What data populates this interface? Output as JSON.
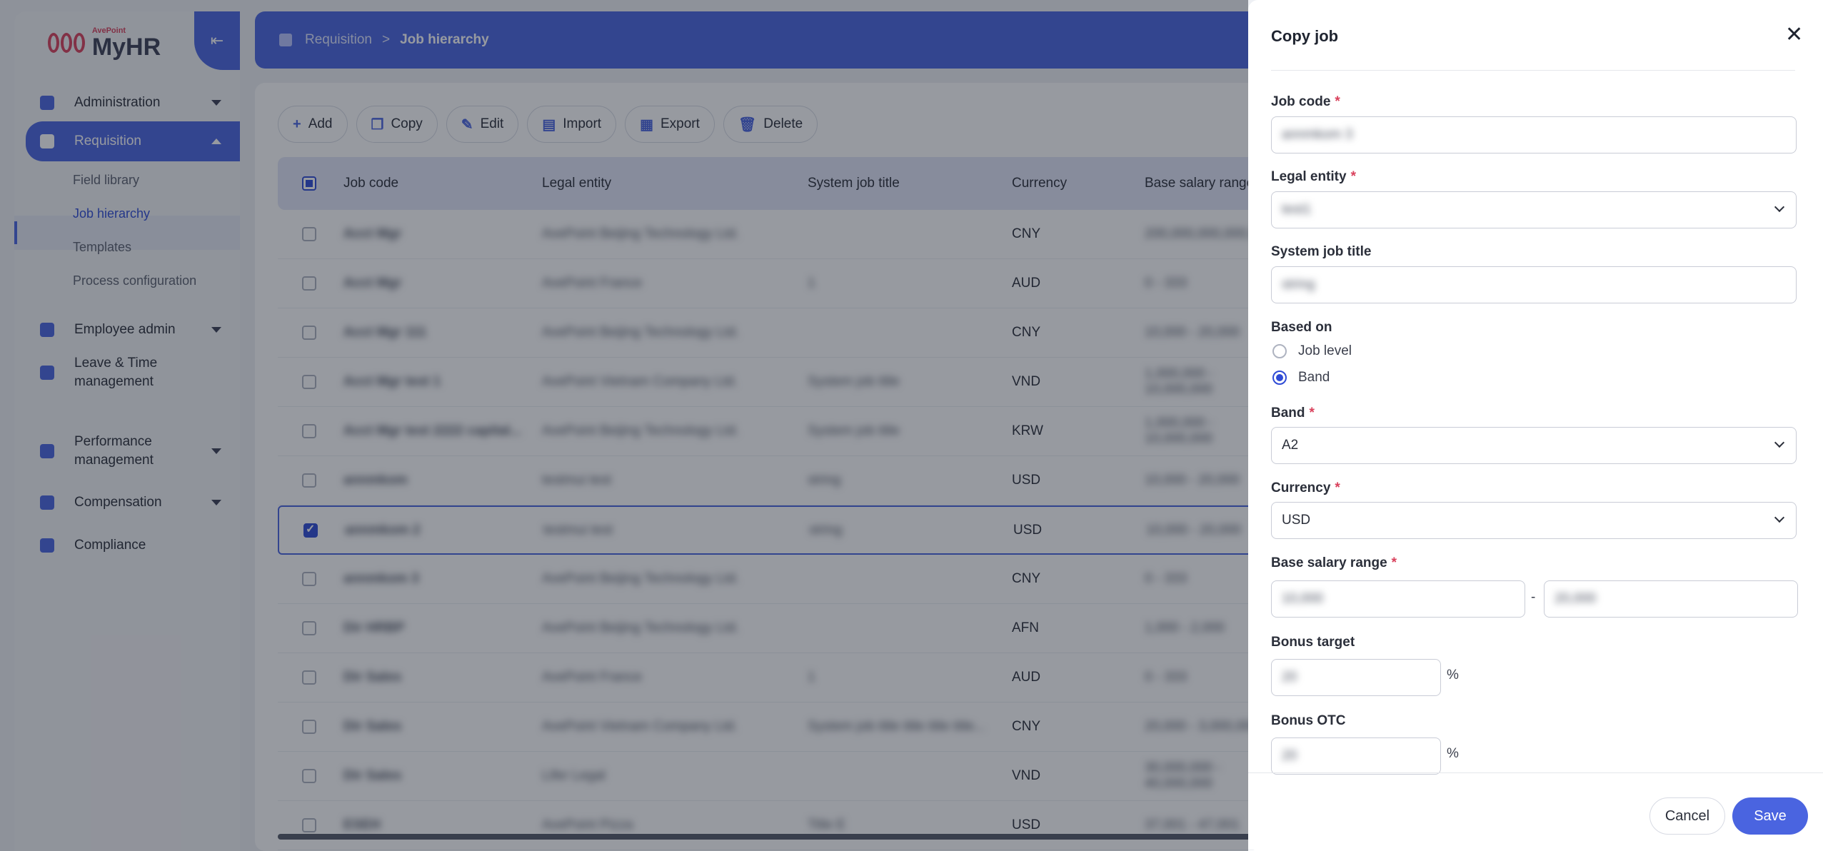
{
  "app": {
    "brand_small": "AvePoint",
    "brand": "MyHR"
  },
  "sidebar": {
    "items": [
      {
        "label": "Administration",
        "icon": "gear-icon"
      },
      {
        "label": "Requisition",
        "icon": "briefcase-icon"
      },
      {
        "label": "Employee admin",
        "icon": "badge-icon"
      },
      {
        "label": "Leave & Time management",
        "icon": "calendar-icon"
      },
      {
        "label": "Performance management",
        "icon": "people-icon"
      },
      {
        "label": "Compensation",
        "icon": "wallet-icon"
      },
      {
        "label": "Compliance",
        "icon": "shield-icon"
      }
    ],
    "leave_line1": "Leave & Time",
    "leave_line2": "management",
    "perf_line1": "Performance",
    "perf_line2": "management",
    "sub_items": [
      "Field library",
      "Job hierarchy",
      "Templates",
      "Process configuration"
    ]
  },
  "breadcrumb": {
    "parent": "Requisition",
    "separator": ">",
    "current": "Job hierarchy"
  },
  "toolbar": {
    "add": "Add",
    "copy": "Copy",
    "edit": "Edit",
    "import": "Import",
    "export": "Export",
    "delete": "Delete"
  },
  "table": {
    "columns": [
      "Job code",
      "Legal entity",
      "System job title",
      "Currency",
      "Base salary range"
    ],
    "rows": [
      {
        "code": "Acct Mgr",
        "entity": "AvePoint Beijing Technology Ltd.",
        "title": "",
        "currency": "CNY",
        "range": "200,000,000,000,000"
      },
      {
        "code": "Acct Mgr",
        "entity": "AvePoint France",
        "title": "1",
        "currency": "AUD",
        "range": "0 - 333"
      },
      {
        "code": "Acct Mgr 111",
        "entity": "AvePoint Beijing Technology Ltd.",
        "title": "",
        "currency": "CNY",
        "range": "10,000 - 20,000"
      },
      {
        "code": "Acct Mgr test 1",
        "entity": "AvePoint Vietnam Company Ltd.",
        "title": "System job title",
        "currency": "VND",
        "range": "1,000,000 - 10,000,000"
      },
      {
        "code": "Acct Mgr test 2222 capital...",
        "entity": "AvePoint Beijing Technology Ltd.",
        "title": "System job title",
        "currency": "KRW",
        "range": "1,000,000 - 10,000,000"
      },
      {
        "code": "annmkom",
        "entity": "testmui test",
        "title": "string",
        "currency": "USD",
        "range": "10,000 - 20,000"
      },
      {
        "code": "annmkom 2",
        "entity": "testmui test",
        "title": "string",
        "currency": "USD",
        "range": "10,000 - 20,000"
      },
      {
        "code": "annmkom 3",
        "entity": "AvePoint Beijing Technology Ltd.",
        "title": "",
        "currency": "CNY",
        "range": "0 - 333"
      },
      {
        "code": "Dir HRBP",
        "entity": "AvePoint Beijing Technology Ltd.",
        "title": "",
        "currency": "AFN",
        "range": "1,000 - 2,000"
      },
      {
        "code": "Dir Sales",
        "entity": "AvePoint France",
        "title": "1",
        "currency": "AUD",
        "range": "0 - 333"
      },
      {
        "code": "Dir Sales",
        "entity": "AvePoint Vietnam Company Ltd.",
        "title": "System job title title title title...",
        "currency": "CNY",
        "range": "20,000 - 3,000,000"
      },
      {
        "code": "Dir Sales",
        "entity": "Lifer Legal",
        "title": "",
        "currency": "VND",
        "range": "30,000,000 - 40,000,000"
      },
      {
        "code": "ESEH",
        "entity": "AvePoint Pizza",
        "title": "Title E",
        "currency": "USD",
        "range": "37,001 - 47,001"
      }
    ]
  },
  "drawer": {
    "title": "Copy job",
    "job_code_label": "Job code",
    "job_code_value": "annmkom 3",
    "legal_entity_label": "Legal entity",
    "legal_entity_value": "test1",
    "system_job_title_label": "System job title",
    "system_job_title_value": "string",
    "based_on_label": "Based on",
    "based_on_options": [
      "Job level",
      "Band"
    ],
    "based_on_selected": "Band",
    "band_label": "Band",
    "band_value": "A2",
    "currency_label": "Currency",
    "currency_value": "USD",
    "salary_label": "Base salary range",
    "salary_min": "10,000",
    "salary_sep": "-",
    "salary_max": "20,000",
    "bonus_target_label": "Bonus target",
    "bonus_target_value": "20",
    "bonus_otc_label": "Bonus OTC",
    "bonus_otc_value": "20",
    "percent": "%",
    "required_mark": "*",
    "cancel": "Cancel",
    "save": "Save"
  },
  "colors": {
    "primary": "#4a64e0",
    "required": "#d9415c"
  }
}
